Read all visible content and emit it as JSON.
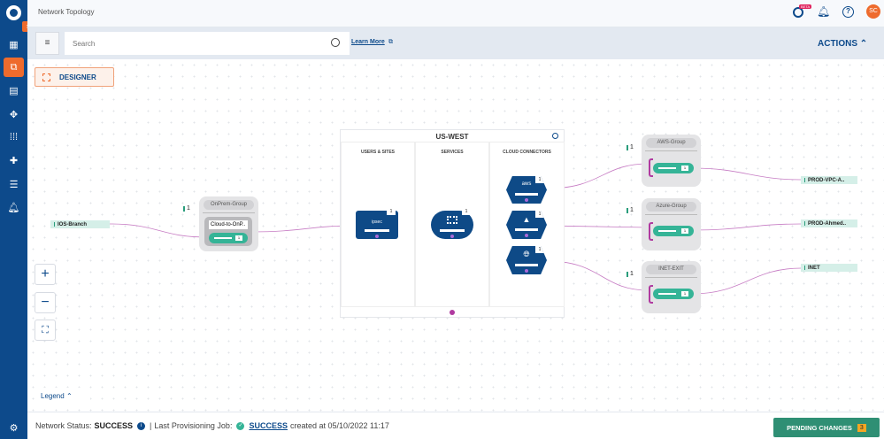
{
  "header": {
    "title": "Network Topology",
    "beta_label": "BETA",
    "avatar_initials": "SC"
  },
  "toolbar": {
    "search_placeholder": "Search",
    "learn_more": "Learn More",
    "actions": "ACTIONS"
  },
  "designer_label": "DESIGNER",
  "region": {
    "title": "US-WEST",
    "columns": [
      "USERS & SITES",
      "SERVICES",
      "CLOUD CONNECTORS"
    ],
    "ipsec_label": "ipsec"
  },
  "left": {
    "site_tag": "IOS-Branch",
    "group": "OnPrem-Group",
    "group_count": "1",
    "connector": "Cloud-to-OnP..",
    "pill_count": "1"
  },
  "node_counts": {
    "ipsec": "1",
    "services": "1",
    "aws": "1",
    "azure": "1",
    "inet": "1"
  },
  "groups": [
    {
      "name": "AWS-Group",
      "count": "1",
      "pill_count": "1",
      "tag": "PROD-VPC-A.."
    },
    {
      "name": "Azure-Group",
      "count": "1",
      "pill_count": "1",
      "tag": "PROD-Ahmed.."
    },
    {
      "name": "INET-EXIT",
      "count": "1",
      "pill_count": "1",
      "tag": "INET"
    }
  ],
  "legend": "Legend",
  "status": {
    "network_label": "Network Status:",
    "network_value": "SUCCESS",
    "sep": "|",
    "job_label": "Last Provisioning Job:",
    "job_value": "SUCCESS",
    "created": "created at 05/10/2022 11:17"
  },
  "pending": {
    "label": "PENDING CHANGES",
    "count": "3"
  },
  "colors": {
    "brand": "#0d4a8b",
    "accent": "#ee6b2d",
    "success": "#2f8f74",
    "link": "#c77dc4"
  }
}
